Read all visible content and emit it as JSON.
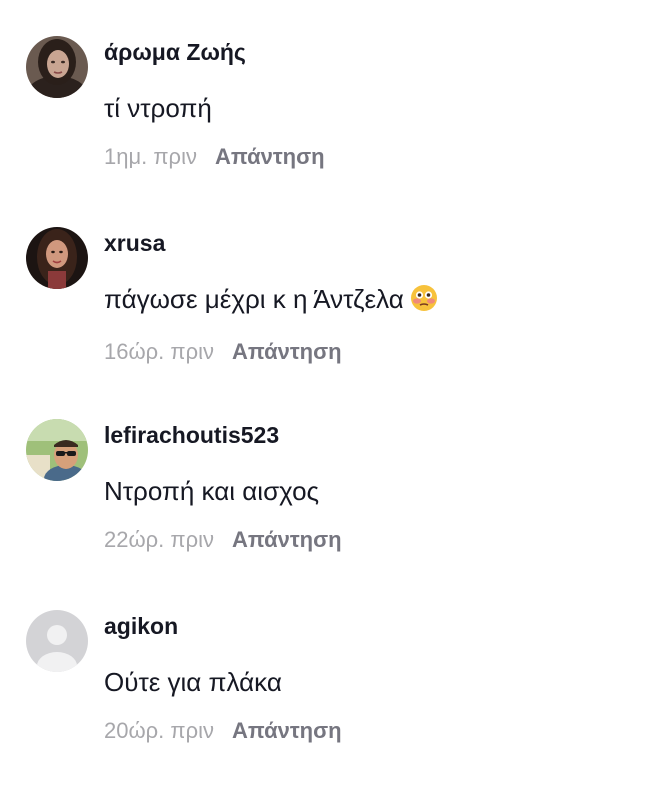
{
  "comments": [
    {
      "username": "άρωμα Ζωής",
      "text": "τί ντροπή",
      "time": "1ημ. πριν",
      "reply_label": "Απάντηση",
      "avatar": "woman-dark-hair-photo"
    },
    {
      "username": "xrusa",
      "text": "πάγωσε μέχρι κ η Άντζελα",
      "emoji": "flushed-face-emoji",
      "time": "16ώρ. πριν",
      "reply_label": "Απάντηση",
      "avatar": "woman-long-hair-photo"
    },
    {
      "username": "lefirachoutis523",
      "text": "Ντροπή και αισχος",
      "time": "22ώρ. πριν",
      "reply_label": "Απάντηση",
      "avatar": "man-sunglasses-photo"
    },
    {
      "username": "agikon",
      "text": "Ούτε για πλάκα",
      "time": "20ώρ. πριν",
      "reply_label": "Απάντηση",
      "avatar": "default-user-icon"
    }
  ],
  "colors": {
    "text": "#161823",
    "time": "#a7a7ab",
    "reply": "#767680",
    "placeholder_avatar": "#d3d3d6"
  }
}
